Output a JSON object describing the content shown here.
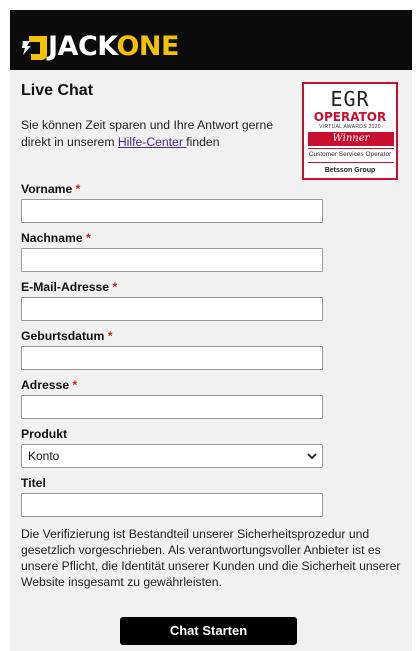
{
  "brand": {
    "logo_part1": "JACK",
    "logo_part2": "ONE",
    "accent_color": "#f2c200",
    "header_color": "#0b0b0b"
  },
  "page": {
    "title": "Live Chat",
    "intro_text": "Sie können Zeit sparen und Ihre Antwort gerne direkt in unserem ",
    "help_link": "Hilfe-Center ",
    "intro_suffix": "finden"
  },
  "award_badge": {
    "egr": "EGR",
    "operator": "OPERATOR",
    "awards_line": "VIRTUAL AWARDS 2020",
    "winner": "Winner",
    "category": "Customer Services Operator",
    "sponsor": "Betsson Group",
    "border_color": "#c8102e"
  },
  "form": {
    "required_marker": "*",
    "fields": [
      {
        "label": "Vorname",
        "required": true,
        "value": ""
      },
      {
        "label": "Nachname",
        "required": true,
        "value": ""
      },
      {
        "label": "E-Mail-Adresse",
        "required": true,
        "value": ""
      },
      {
        "label": "Geburtsdatum",
        "required": true,
        "value": ""
      },
      {
        "label": "Adresse",
        "required": true,
        "value": ""
      }
    ],
    "product": {
      "label": "Produkt",
      "selected": "Konto"
    },
    "title_field": {
      "label": "Titel",
      "value": ""
    }
  },
  "disclaimer": "Die Verifizierung ist Bestandteil unserer Sicherheitsprozedur und gesetzlich vorgeschrieben. Als verantwortungsvoller Anbieter ist es unsere Pflicht, die Identität unserer Kunden und die Sicherheit unserer Website insgesamt zu gewährleisten.",
  "submit_label": "Chat Starten"
}
